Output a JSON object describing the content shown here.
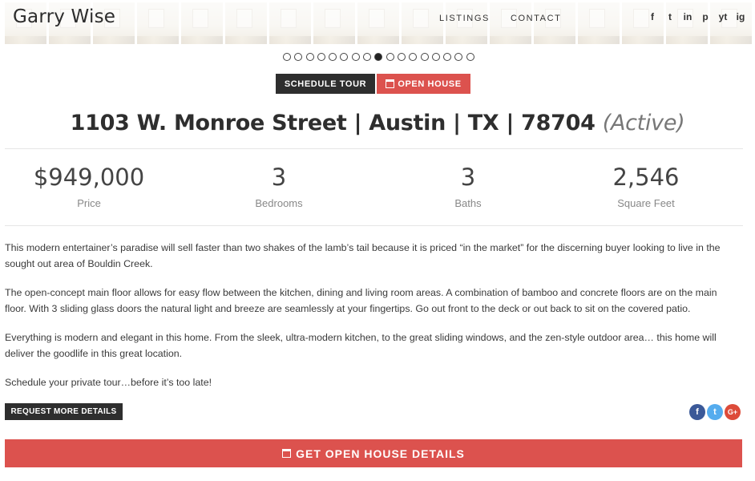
{
  "header": {
    "logo": "Garry Wise",
    "nav": [
      {
        "label": "LISTINGS"
      },
      {
        "label": "CONTACT"
      }
    ],
    "social_icons": [
      "facebook-icon",
      "twitter-icon",
      "linkedin-icon",
      "pinterest-icon",
      "youtube-icon",
      "instagram-icon"
    ],
    "social_glyphs": [
      "f",
      "t",
      "in",
      "p",
      "yt",
      "ig"
    ]
  },
  "slider": {
    "total": 17,
    "active": 9
  },
  "actions": {
    "schedule_tour": "SCHEDULE TOUR",
    "open_house": "OPEN HOUSE"
  },
  "listing": {
    "title": "1103 W. Monroe Street | Austin | TX | 78704",
    "status": "(Active)",
    "stats": [
      {
        "value": "$949,000",
        "label": "Price"
      },
      {
        "value": "3",
        "label": "Bedrooms"
      },
      {
        "value": "3",
        "label": "Baths"
      },
      {
        "value": "2,546",
        "label": "Square Feet"
      }
    ],
    "description": [
      "This modern entertainer’s paradise will sell faster than two shakes of the lamb’s tail because it is priced “in the market” for the discerning buyer looking to live in the sought out area of Bouldin Creek.",
      "The open-concept main floor allows for easy flow between the kitchen, dining and living room areas. A combination of bamboo and concrete floors are on the main floor. With 3 sliding glass doors the natural light and breeze are seamlessly at your fingertips. Go out front to the deck or out back to sit on the covered patio.",
      "Everything is modern and elegant in this home. From the sleek, ultra-modern kitchen, to the great sliding windows, and the zen-style outdoor area… this home will deliver the goodlife in this great location.",
      "Schedule your private tour…before it’s too late!"
    ]
  },
  "request_button": "REQUEST MORE DETAILS",
  "share": [
    "f",
    "t",
    "G+"
  ],
  "open_house_details": "GET OPEN HOUSE DETAILS",
  "colors": {
    "accent_red": "#dc524e",
    "dark": "#2e2e2e"
  }
}
